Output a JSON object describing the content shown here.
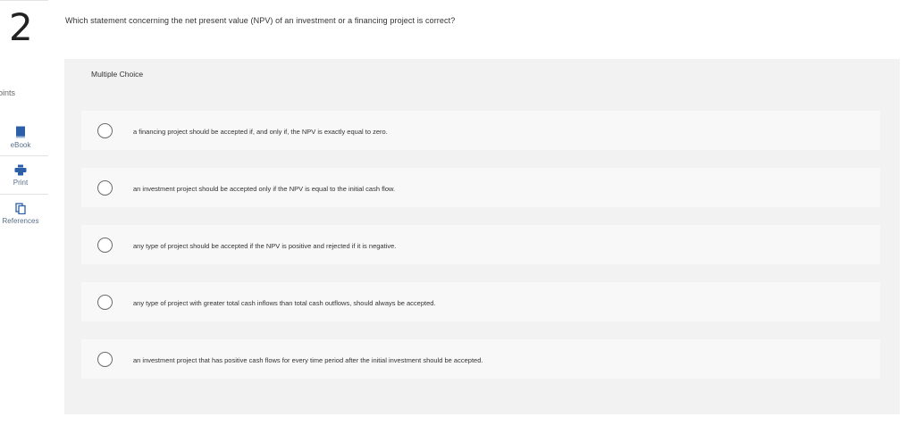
{
  "question": {
    "number": "2",
    "text": "Which statement concerning the net present value (NPV) of an investment or a financing project is correct?"
  },
  "rail": {
    "points_label": "oints",
    "items": [
      {
        "label": "eBook",
        "icon": "book-icon"
      },
      {
        "label": "Print",
        "icon": "print-icon"
      },
      {
        "label": "References",
        "icon": "references-icon"
      }
    ]
  },
  "answers": {
    "header": "Multiple Choice",
    "options": [
      "a financing project should be accepted if, and only if, the NPV is exactly equal to zero.",
      "an investment project should be accepted only if the NPV is equal to the initial cash flow.",
      "any type of project should be accepted if the NPV is positive and rejected if it is negative.",
      "any type of project with greater total cash inflows than total cash outflows, should always be accepted.",
      "an investment project that has positive cash flows for every time period after the initial investment should be accepted."
    ]
  },
  "colors": {
    "panel_bg": "#f2f2f2",
    "option_bg": "#f8f8f8",
    "icon_blue": "#2d5fa8",
    "rail_label": "#5a6f8a"
  }
}
